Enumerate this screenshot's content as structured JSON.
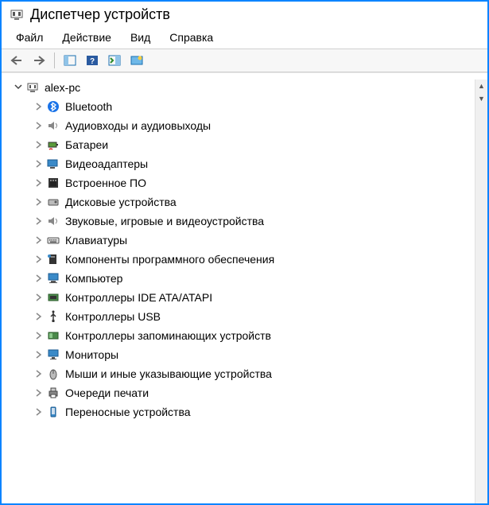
{
  "window": {
    "title": "Диспетчер устройств"
  },
  "menubar": {
    "file": "Файл",
    "action": "Действие",
    "view": "Вид",
    "help": "Справка"
  },
  "tree": {
    "root": {
      "label": "alex-pc",
      "icon": "computer-icon",
      "expanded": true
    },
    "items": [
      {
        "label": "Bluetooth",
        "icon": "bluetooth-icon"
      },
      {
        "label": "Аудиовходы и аудиовыходы",
        "icon": "speaker-icon"
      },
      {
        "label": "Батареи",
        "icon": "battery-icon"
      },
      {
        "label": "Видеоадаптеры",
        "icon": "display-adapter-icon"
      },
      {
        "label": "Встроенное ПО",
        "icon": "firmware-icon"
      },
      {
        "label": "Дисковые устройства",
        "icon": "disk-icon"
      },
      {
        "label": "Звуковые, игровые и видеоустройства",
        "icon": "sound-icon"
      },
      {
        "label": "Клавиатуры",
        "icon": "keyboard-icon"
      },
      {
        "label": "Компоненты программного обеспечения",
        "icon": "software-component-icon"
      },
      {
        "label": "Компьютер",
        "icon": "pc-icon"
      },
      {
        "label": "Контроллеры IDE ATA/ATAPI",
        "icon": "ide-controller-icon"
      },
      {
        "label": "Контроллеры USB",
        "icon": "usb-controller-icon"
      },
      {
        "label": "Контроллеры запоминающих устройств",
        "icon": "storage-controller-icon"
      },
      {
        "label": "Мониторы",
        "icon": "monitor-icon"
      },
      {
        "label": "Мыши и иные указывающие устройства",
        "icon": "mouse-icon"
      },
      {
        "label": "Очереди печати",
        "icon": "printer-icon"
      },
      {
        "label": "Переносные устройства",
        "icon": "portable-device-icon"
      }
    ]
  }
}
